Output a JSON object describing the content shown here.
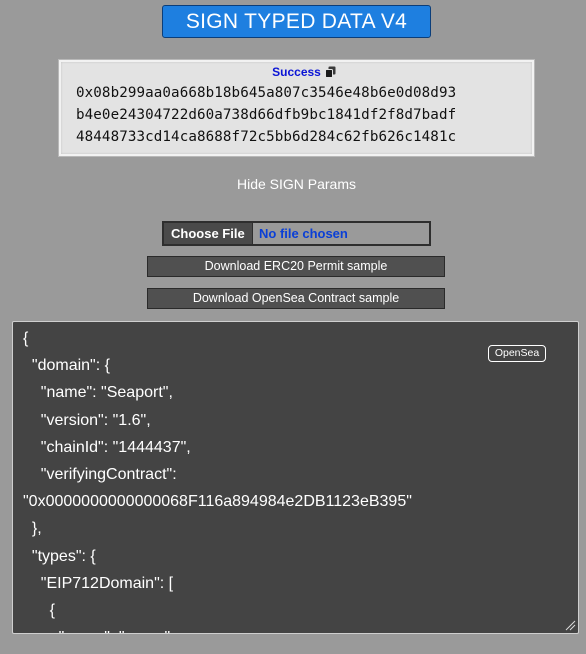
{
  "header": {
    "title": "SIGN TYPED DATA V4"
  },
  "result": {
    "status": "Success",
    "copy_icon": "copy-icon",
    "signature_lines": [
      "0x08b299aa0a668b18b645a807c3546e48b6e0d08d93",
      "b4e0e24304722d60a738d66dfb9bc1841df2f8d7badf",
      "48448733cd14ca8688f72c5bb6d284c62fb626c1481c"
    ]
  },
  "params_toggle": "Hide SIGN Params",
  "file_input": {
    "button_label": "Choose File",
    "status": "No file chosen"
  },
  "buttons": {
    "erc20_sample": "Download ERC20 Permit sample",
    "opensea_sample": "Download OpenSea Contract sample"
  },
  "editor": {
    "badge": "OpenSea",
    "lines": [
      "{",
      "  \"domain\": {",
      "    \"name\": \"Seaport\",",
      "    \"version\": \"1.6\",",
      "    \"chainId\": \"1444437\",",
      "    \"verifyingContract\":",
      "\"0x0000000000000068F116a894984e2DB1123eB395\"",
      "  },",
      "  \"types\": {",
      "    \"EIP712Domain\": [",
      "      {",
      "        \"name\": \"name\","
    ]
  },
  "colors": {
    "page_background": "#9a9a9a",
    "title_button": "#1e7fe0",
    "status_text": "#0a14d6",
    "editor_background": "#444444"
  }
}
